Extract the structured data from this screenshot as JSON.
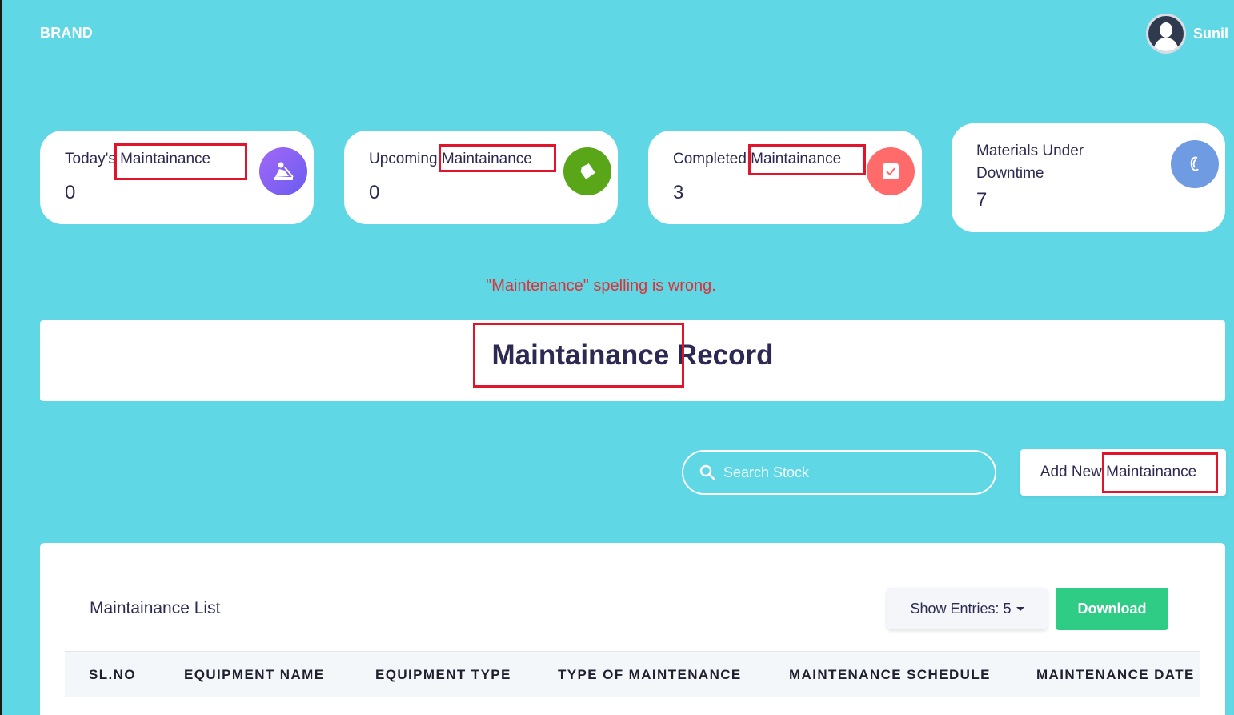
{
  "brand": "BRAND",
  "user": {
    "name": "Sunil"
  },
  "cards": [
    {
      "title": "Today's Maintainance",
      "value": "0",
      "icon": "person-digging-icon",
      "color": "#8a5cf6"
    },
    {
      "title": "Upcoming Maintainance",
      "value": "0",
      "icon": "tag-icon",
      "color": "#5aa619"
    },
    {
      "title": "Completed Maintainance",
      "value": "3",
      "icon": "calendar-check-icon",
      "color": "#ff6b6b"
    },
    {
      "title": "Materials Under Downtime",
      "value": "7",
      "icon": "clip-icon",
      "color": "#6f9be3"
    }
  ],
  "annotation": "\"Maintenance\" spelling is wrong.",
  "record_title": "Maintainance Record",
  "search": {
    "placeholder": "Search Stock"
  },
  "add_button": "Add New Maintainance",
  "list": {
    "title": "Maintainance List",
    "show_entries": "Show Entries: 5",
    "download": "Download",
    "columns": [
      "SL.NO",
      "EQUIPMENT NAME",
      "EQUIPMENT TYPE",
      "TYPE OF MAINTENANCE",
      "MAINTENANCE SCHEDULE",
      "MAINTENANCE DATE"
    ]
  },
  "colors": {
    "background": "#5fd7e4",
    "highlight": "#e0142a",
    "accent_green": "#2ecc85",
    "text_dark": "#2c2a52"
  }
}
